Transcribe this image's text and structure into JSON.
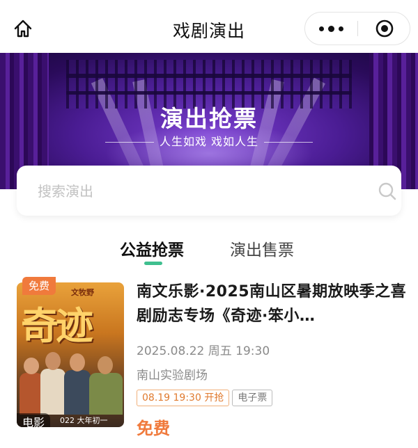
{
  "navbar": {
    "title": "戏剧演出",
    "home_icon": "home-icon",
    "more_icon": "more-dots-icon",
    "close_icon": "record-close-icon"
  },
  "banner": {
    "title": "演出抢票",
    "subtitle": "人生如戏 戏如人生"
  },
  "search": {
    "placeholder": "搜索演出",
    "icon": "search-icon"
  },
  "tabs": [
    {
      "label": "公益抢票",
      "active": true
    },
    {
      "label": "演出售票",
      "active": false
    }
  ],
  "shows": [
    {
      "badge": "免费",
      "type": "电影",
      "poster_text": "奇迹",
      "poster_top_text": "文牧野",
      "poster_year_text": "022 大年初一",
      "title": "南文乐影·2025南山区暑期放映季之喜剧励志专场《奇迹·笨小…",
      "datetime": "2025.08.22 周五 19:30",
      "venue": "南山实验剧场",
      "sale_tag": "08.19 19:30 开抢",
      "ticket_tag": "电子票",
      "price": "免费"
    }
  ],
  "colors": {
    "accent_green": "#3fbf8f",
    "price_orange": "#f07a3c",
    "banner_purple": "#4a1c93"
  }
}
